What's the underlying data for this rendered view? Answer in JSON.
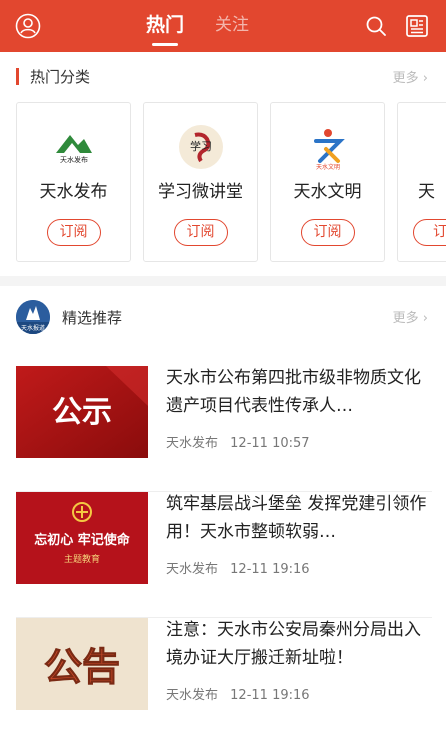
{
  "header": {
    "tabs": [
      {
        "label": "热门",
        "active": true
      },
      {
        "label": "关注",
        "active": false
      }
    ],
    "icons": [
      "user-icon",
      "search-icon",
      "news-icon"
    ],
    "accent_color": "#e2472f"
  },
  "categories": {
    "title": "热门分类",
    "more": "更多",
    "items": [
      {
        "name": "天水发布",
        "subscribe": "订阅",
        "logo_text": "天水发布"
      },
      {
        "name": "学习微讲堂",
        "subscribe": "订阅",
        "logo_text": "学习"
      },
      {
        "name": "天水文明",
        "subscribe": "订阅",
        "logo_text": "天水文明"
      },
      {
        "name": "天",
        "subscribe": "订",
        "logo_text": ""
      }
    ]
  },
  "recommend": {
    "title": "精选推荐",
    "more": "更多",
    "avatar_text": "天水报道",
    "items": [
      {
        "title": "天水市公布第四批市级非物质文化遗产项目代表性传承人…",
        "source": "天水发布",
        "time": "12-11 10:57",
        "thumb_text": "公示"
      },
      {
        "title": "筑牢基层战斗堡垒 发挥党建引领作用！天水市整顿软弱…",
        "source": "天水发布",
        "time": "12-11 19:16",
        "thumb_text": "忘初心 牢记使命",
        "thumb_sub": "主题教育"
      },
      {
        "title": "注意：天水市公安局秦州分局出入境办证大厅搬迁新址啦！",
        "source": "天水发布",
        "time": "12-11 19:16",
        "thumb_text": "公告"
      }
    ]
  }
}
